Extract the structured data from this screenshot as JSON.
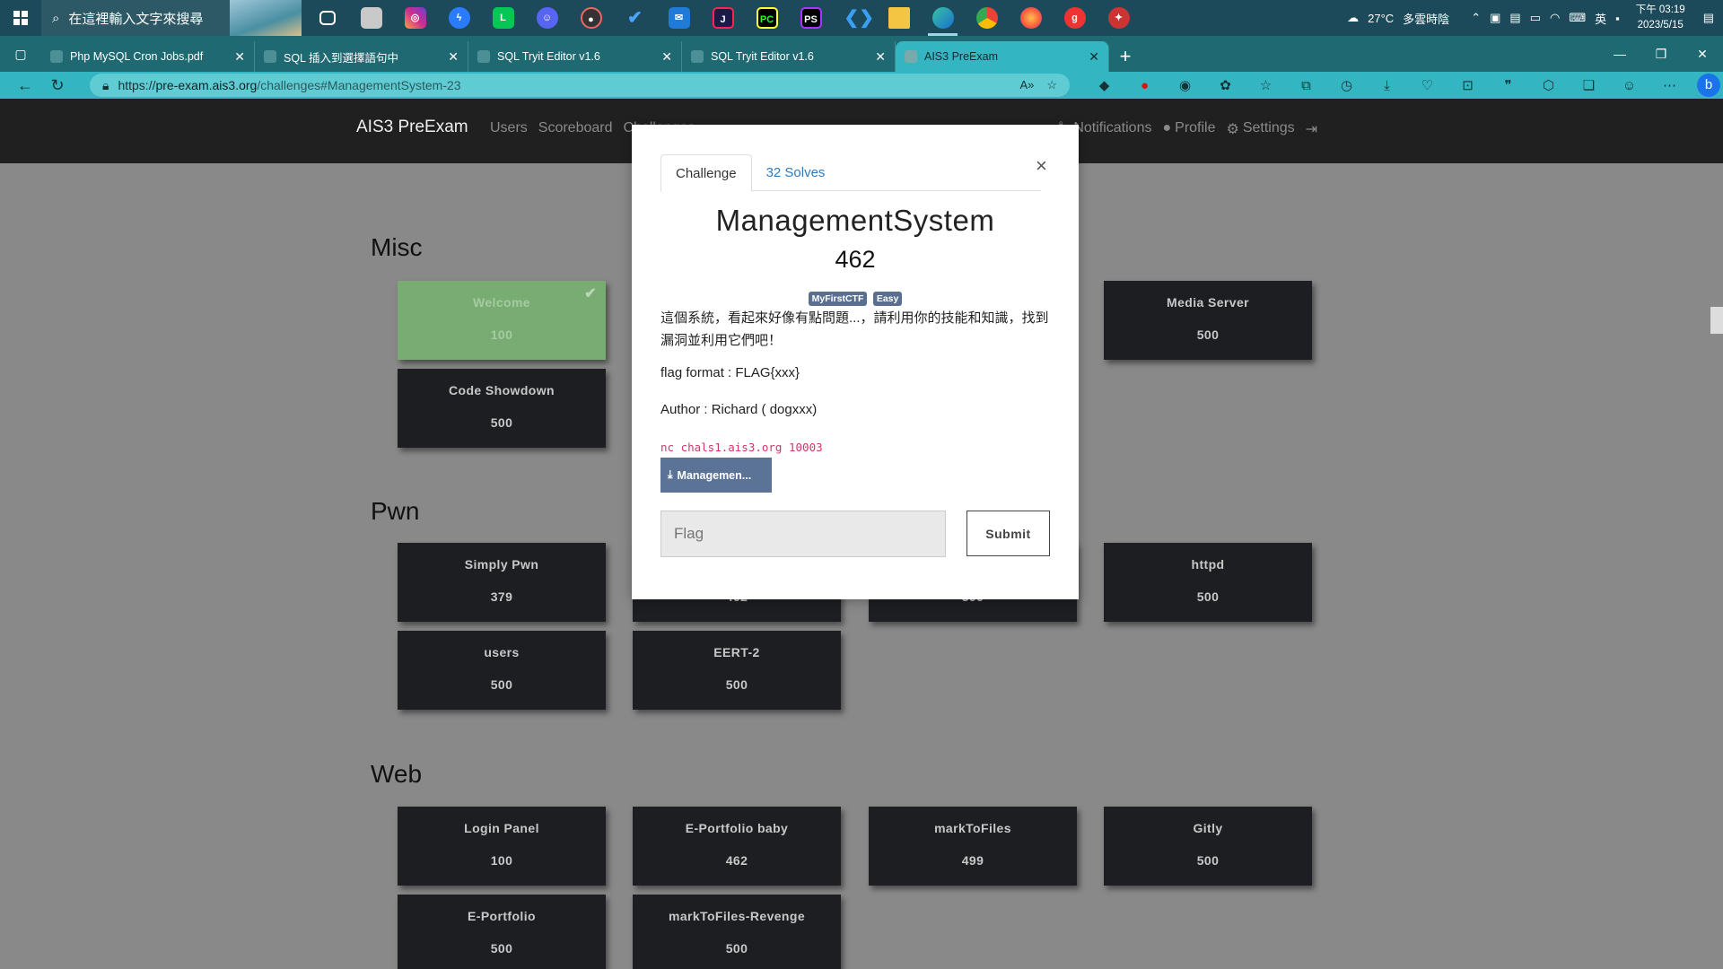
{
  "taskbar": {
    "search_placeholder": "在這裡輸入文字來搜尋",
    "weather": "27°C",
    "weather_desc": "多雲時陰",
    "ime": "英",
    "clock_time": "下午 03:19",
    "clock_date": "2023/5/15",
    "apps": [
      "task-view",
      "photos",
      "instagram",
      "messenger",
      "line",
      "discord",
      "davinci",
      "todo",
      "mail",
      "jetbrains-toolbox",
      "pycharm",
      "phpstorm",
      "vscode",
      "file-explorer",
      "edge",
      "chrome",
      "firefox",
      "git-app",
      "other-app"
    ]
  },
  "tabs": [
    {
      "title": "Php MySQL Cron Jobs.pdf",
      "active": false
    },
    {
      "title": "SQL 插入到選擇語句中",
      "active": false
    },
    {
      "title": "SQL Tryit Editor v1.6",
      "active": false
    },
    {
      "title": "SQL Tryit Editor v1.6",
      "active": false
    },
    {
      "title": "AIS3 PreExam",
      "active": true
    }
  ],
  "address": {
    "scheme": "https://",
    "host": "pre-exam.ais3.org",
    "path": "/challenges#ManagementSystem-23"
  },
  "site": {
    "brand": "AIS3 PreExam",
    "nav": [
      "Users",
      "Scoreboard",
      "Challenges"
    ],
    "right_nav": [
      "Notifications",
      "Profile",
      "Settings"
    ]
  },
  "categories": [
    {
      "name": "Misc",
      "challenges": [
        {
          "name": "Welcome",
          "points": "100",
          "solved": true
        },
        {
          "name": "Media Server",
          "points": "500",
          "solved": false
        },
        {
          "name": "Code Showdown",
          "points": "500",
          "solved": false
        }
      ]
    },
    {
      "name": "Pwn",
      "challenges": [
        {
          "name": "Simply Pwn",
          "points": "379",
          "solved": false
        },
        {
          "name": "",
          "points": "462",
          "solved": false
        },
        {
          "name": "",
          "points": "500",
          "solved": false
        },
        {
          "name": "httpd",
          "points": "500",
          "solved": false
        },
        {
          "name": "users",
          "points": "500",
          "solved": false
        },
        {
          "name": "EERT-2",
          "points": "500",
          "solved": false
        }
      ]
    },
    {
      "name": "Web",
      "challenges": [
        {
          "name": "Login Panel",
          "points": "100",
          "solved": false
        },
        {
          "name": "E-Portfolio baby",
          "points": "462",
          "solved": false
        },
        {
          "name": "markToFiles",
          "points": "499",
          "solved": false
        },
        {
          "name": "Gitly",
          "points": "500",
          "solved": false
        },
        {
          "name": "E-Portfolio",
          "points": "500",
          "solved": false
        },
        {
          "name": "markToFiles-Revenge",
          "points": "500",
          "solved": false
        }
      ]
    }
  ],
  "modal": {
    "tab_challenge": "Challenge",
    "tab_solves": "32 Solves",
    "close": "×",
    "title": "ManagementSystem",
    "value": "462",
    "tags": [
      "MyFirstCTF",
      "Easy"
    ],
    "description": "這個系統，看起來好像有點問題...，請利用你的技能和知識，找到漏洞並利用它們吧！",
    "flag_format": "flag format : FLAG{xxx}",
    "author": "Author : Richard ( dogxxx)",
    "connection": "nc chals1.ais3.org 10003",
    "file_label": "Managemen...",
    "flag_placeholder": "Flag",
    "submit_label": "Submit"
  }
}
